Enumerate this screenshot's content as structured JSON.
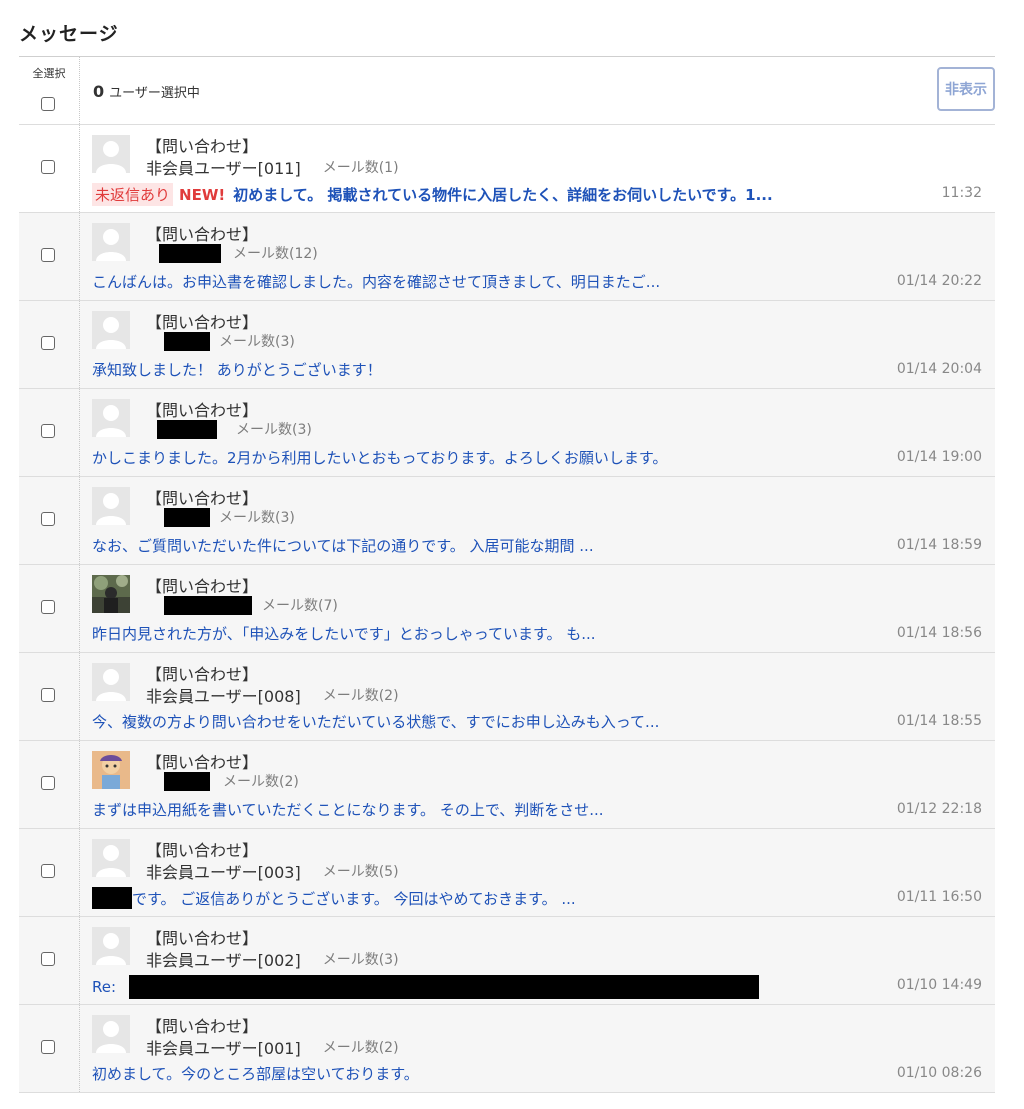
{
  "page_title": "メッセージ",
  "header": {
    "select_all": "全選択",
    "selected_count": "0",
    "selected_suffix": "ユーザー選択中",
    "hide_button": "非表示"
  },
  "messages": [
    {
      "tag": "【問い合わせ】",
      "sender": "非会員ユーザー[011]",
      "mail_count": "メール数(1)",
      "unreplied": "未返信あり",
      "new_label": "NEW!",
      "preview_prefix": "",
      "preview": "初めまして。 掲載されている物件に入居したく、詳細をお伺いしたいです。1...",
      "time": "11:32",
      "avatar": "default-avatar-icon"
    },
    {
      "tag": "【問い合わせ】",
      "sender": "",
      "mail_count": "メール数(12)",
      "preview_prefix": "",
      "preview": "こんばんは。お申込書を確認しました。内容を確認させて頂きまして、明日またご...",
      "time": "01/14 20:22",
      "avatar": "default-avatar-icon"
    },
    {
      "tag": "【問い合わせ】",
      "sender": "",
      "mail_count": "メール数(3)",
      "preview_prefix": "",
      "preview": "承知致しました！ ありがとうございます！",
      "time": "01/14 20:04",
      "avatar": "default-avatar-icon"
    },
    {
      "tag": "【問い合わせ】",
      "sender": "",
      "mail_count": "メール数(3)",
      "preview_prefix": "",
      "preview": "かしこまりました。2月から利用したいとおもっております。よろしくお願いします。",
      "time": "01/14 19:00",
      "avatar": "default-avatar-icon"
    },
    {
      "tag": "【問い合わせ】",
      "sender": "",
      "mail_count": "メール数(3)",
      "preview_prefix": "",
      "preview": "なお、ご質問いただいた件については下記の通りです。 入居可能な期間 ...",
      "time": "01/14 18:59",
      "avatar": "default-avatar-icon"
    },
    {
      "tag": "【問い合わせ】",
      "sender": "",
      "mail_count": "メール数(7)",
      "preview_prefix": "",
      "preview": "昨日内見された方が、「申込みをしたいです」とおっしゃっています。 も...",
      "time": "01/14 18:56",
      "avatar": "photo-avatar-icon"
    },
    {
      "tag": "【問い合わせ】",
      "sender": "非会員ユーザー[008]",
      "mail_count": "メール数(2)",
      "preview_prefix": "",
      "preview": "今、複数の方より問い合わせをいただいている状態で、すでにお申し込みも入って...",
      "time": "01/14 18:55",
      "avatar": "default-avatar-icon"
    },
    {
      "tag": "【問い合わせ】",
      "sender": "",
      "mail_count": "メール数(2)",
      "preview_prefix": "",
      "preview": "まずは申込用紙を書いていただくことになります。 その上で、判断をさせ...",
      "time": "01/12 22:18",
      "avatar": "illustration-avatar-icon"
    },
    {
      "tag": "【問い合わせ】",
      "sender": "非会員ユーザー[003]",
      "mail_count": "メール数(5)",
      "preview_prefix": "",
      "preview": "です。 ご返信ありがとうございます。 今回はやめておきます。 ...",
      "time": "01/11 16:50",
      "avatar": "default-avatar-icon"
    },
    {
      "tag": "【問い合わせ】",
      "sender": "非会員ユーザー[002]",
      "mail_count": "メール数(3)",
      "preview_prefix": "Re:",
      "preview": "",
      "time": "01/10 14:49",
      "avatar": "default-avatar-icon"
    },
    {
      "tag": "【問い合わせ】",
      "sender": "非会員ユーザー[001]",
      "mail_count": "メール数(2)",
      "preview_prefix": "",
      "preview": "初めまして。今のところ部屋は空いております。",
      "time": "01/10 08:26",
      "avatar": "default-avatar-icon"
    }
  ]
}
